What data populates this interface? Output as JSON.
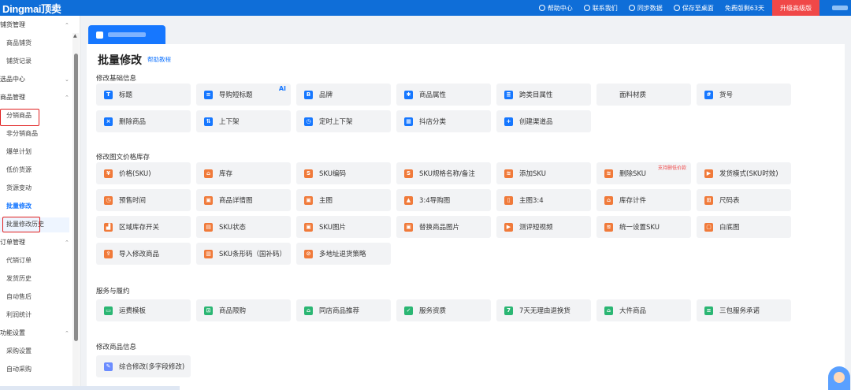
{
  "app": {
    "logo": "Dingmai顶卖"
  },
  "topnav": [
    {
      "label": "帮助中心",
      "icon": "help-circle-icon"
    },
    {
      "label": "联系我们",
      "icon": "clock-icon"
    },
    {
      "label": "同步数据",
      "icon": "refresh-icon"
    },
    {
      "label": "保存至桌面",
      "icon": "download-icon"
    },
    {
      "label": "免费版剩63天",
      "icon": ""
    }
  ],
  "upgrade_label": "升级高级版",
  "sidebar": [
    {
      "type": "group",
      "label": "铺货管理",
      "chev": "^"
    },
    {
      "type": "item",
      "label": "商品铺货"
    },
    {
      "type": "item",
      "label": "铺货记录"
    },
    {
      "type": "group",
      "label": "选品中心",
      "chev": "v"
    },
    {
      "type": "group",
      "label": "商品管理",
      "chev": "^"
    },
    {
      "type": "item",
      "label": "分销商品"
    },
    {
      "type": "item",
      "label": "非分销商品"
    },
    {
      "type": "item",
      "label": "爆单计划"
    },
    {
      "type": "item",
      "label": "低价货源"
    },
    {
      "type": "item",
      "label": "货源变动"
    },
    {
      "type": "item",
      "label": "批量修改",
      "active": true
    },
    {
      "type": "item",
      "label": "批量修改历史"
    },
    {
      "type": "group",
      "label": "订单管理",
      "chev": "^"
    },
    {
      "type": "item",
      "label": "代销订单"
    },
    {
      "type": "item",
      "label": "发货历史"
    },
    {
      "type": "item",
      "label": "自动售后"
    },
    {
      "type": "item",
      "label": "利润统计"
    },
    {
      "type": "group",
      "label": "功能设置",
      "chev": "^"
    },
    {
      "type": "item",
      "label": "采购设置"
    },
    {
      "type": "item",
      "label": "自动采购"
    }
  ],
  "page": {
    "title": "批量修改",
    "help_link": "帮助教程"
  },
  "sections": [
    {
      "title": "修改基础信息",
      "rows": [
        [
          {
            "label": "标题",
            "icon": "title-icon",
            "color": "#1677ff",
            "glyph": "T"
          },
          {
            "label": "导购短标题",
            "icon": "short-title-icon",
            "color": "#1677ff",
            "glyph": "≡",
            "badge": "AI"
          },
          {
            "label": "品牌",
            "icon": "brand-icon",
            "color": "#1677ff",
            "glyph": "B"
          },
          {
            "label": "商品属性",
            "icon": "gear-icon",
            "color": "#1677ff",
            "glyph": "✱"
          },
          {
            "label": "跨类目属性",
            "icon": "cross-category-icon",
            "color": "#1677ff",
            "glyph": "≣"
          },
          {
            "label": "面料材质",
            "icon": "",
            "color": "",
            "glyph": ""
          },
          {
            "label": "货号",
            "icon": "item-number-icon",
            "color": "#1677ff",
            "glyph": "#"
          }
        ],
        [
          {
            "label": "删除商品",
            "icon": "delete-circle-icon",
            "color": "#1677ff",
            "glyph": "×"
          },
          {
            "label": "上下架",
            "icon": "shelf-toggle-icon",
            "color": "#1677ff",
            "glyph": "⇅"
          },
          {
            "label": "定时上下架",
            "icon": "timer-icon",
            "color": "#1677ff",
            "glyph": "◷"
          },
          {
            "label": "抖店分类",
            "icon": "category-icon",
            "color": "#1677ff",
            "glyph": "▦"
          },
          {
            "label": "创建渠道品",
            "icon": "channel-icon",
            "color": "#1677ff",
            "glyph": "+"
          }
        ]
      ]
    },
    {
      "title": "修改图文价格库存",
      "rows": [
        [
          {
            "label": "价格(SKU)",
            "icon": "price-icon",
            "color": "#f07a3a",
            "glyph": "¥"
          },
          {
            "label": "库存",
            "icon": "stock-icon",
            "color": "#f07a3a",
            "glyph": "⌂"
          },
          {
            "label": "SKU编码",
            "icon": "sku-code-icon",
            "color": "#f07a3a",
            "glyph": "S"
          },
          {
            "label": "SKU规格名称/备注",
            "icon": "sku-spec-icon",
            "color": "#f07a3a",
            "glyph": "S"
          },
          {
            "label": "添加SKU",
            "icon": "add-sku-icon",
            "color": "#f07a3a",
            "glyph": "≋"
          },
          {
            "label": "删除SKU",
            "icon": "delete-sku-icon",
            "color": "#f07a3a",
            "glyph": "≋",
            "badge": "支持删低价款",
            "badge_red": true
          },
          {
            "label": "发货模式(SKU时效)",
            "icon": "shipping-icon",
            "color": "#f07a3a",
            "glyph": "▶"
          }
        ],
        [
          {
            "label": "预售时间",
            "icon": "presale-clock-icon",
            "color": "#f07a3a",
            "glyph": "◷"
          },
          {
            "label": "商品详情图",
            "icon": "detail-image-icon",
            "color": "#f07a3a",
            "glyph": "▣"
          },
          {
            "label": "主图",
            "icon": "main-image-icon",
            "color": "#f07a3a",
            "glyph": "▣"
          },
          {
            "label": "3:4导购图",
            "icon": "ratio-image-icon",
            "color": "#f07a3a",
            "glyph": "▲"
          },
          {
            "label": "主图3:4",
            "icon": "main-image-ratio-icon",
            "color": "#f07a3a",
            "glyph": "▯"
          },
          {
            "label": "库存计件",
            "icon": "stock-count-icon",
            "color": "#f07a3a",
            "glyph": "⌂"
          },
          {
            "label": "尺码表",
            "icon": "size-chart-icon",
            "color": "#f07a3a",
            "glyph": "⊞"
          }
        ],
        [
          {
            "label": "区域库存开关",
            "icon": "region-stock-icon",
            "color": "#f07a3a",
            "glyph": "▟"
          },
          {
            "label": "SKU状态",
            "icon": "sku-status-icon",
            "color": "#f07a3a",
            "glyph": "▤"
          },
          {
            "label": "SKU图片",
            "icon": "sku-image-icon",
            "color": "#f07a3a",
            "glyph": "▣"
          },
          {
            "label": "替换商品图片",
            "icon": "replace-image-icon",
            "color": "#f07a3a",
            "glyph": "▣"
          },
          {
            "label": "测评短视频",
            "icon": "video-icon",
            "color": "#f07a3a",
            "glyph": "▶"
          },
          {
            "label": "统一设置SKU",
            "icon": "unify-sku-icon",
            "color": "#f07a3a",
            "glyph": "≋"
          },
          {
            "label": "白底图",
            "icon": "white-bg-image-icon",
            "color": "#f07a3a",
            "glyph": "▢"
          }
        ],
        [
          {
            "label": "导入修改商品",
            "icon": "import-icon",
            "color": "#f07a3a",
            "glyph": "⇪"
          },
          {
            "label": "SKU条形码（国补码）",
            "icon": "barcode-icon",
            "color": "#f07a3a",
            "glyph": "▥"
          },
          {
            "label": "多地址退货策略",
            "icon": "return-policy-icon",
            "color": "#f07a3a",
            "glyph": "⊘"
          }
        ]
      ]
    },
    {
      "title": "服务与履约",
      "rows": [
        [
          {
            "label": "运费模板",
            "icon": "freight-template-icon",
            "color": "#2bb673",
            "glyph": "▭"
          },
          {
            "label": "商品限购",
            "icon": "cart-icon",
            "color": "#2bb673",
            "glyph": "⊡"
          },
          {
            "label": "同店商品推荐",
            "icon": "recommend-icon",
            "color": "#2bb673",
            "glyph": "⌂"
          },
          {
            "label": "服务资质",
            "icon": "qualification-icon",
            "color": "#2bb673",
            "glyph": "✓"
          },
          {
            "label": "7天无理由退换货",
            "icon": "seven-day-return-icon",
            "color": "#2bb673",
            "glyph": "7"
          },
          {
            "label": "大件商品",
            "icon": "bulky-item-icon",
            "color": "#2bb673",
            "glyph": "⌂"
          },
          {
            "label": "三包服务承诺",
            "icon": "warranty-icon",
            "color": "#2bb673",
            "glyph": "≡"
          }
        ]
      ]
    },
    {
      "title": "修改商品信息",
      "rows": [
        [
          {
            "label": "综合修改(多字段修改)",
            "icon": "multi-edit-icon",
            "color": "#6b8cff",
            "glyph": "✎"
          }
        ]
      ]
    }
  ]
}
